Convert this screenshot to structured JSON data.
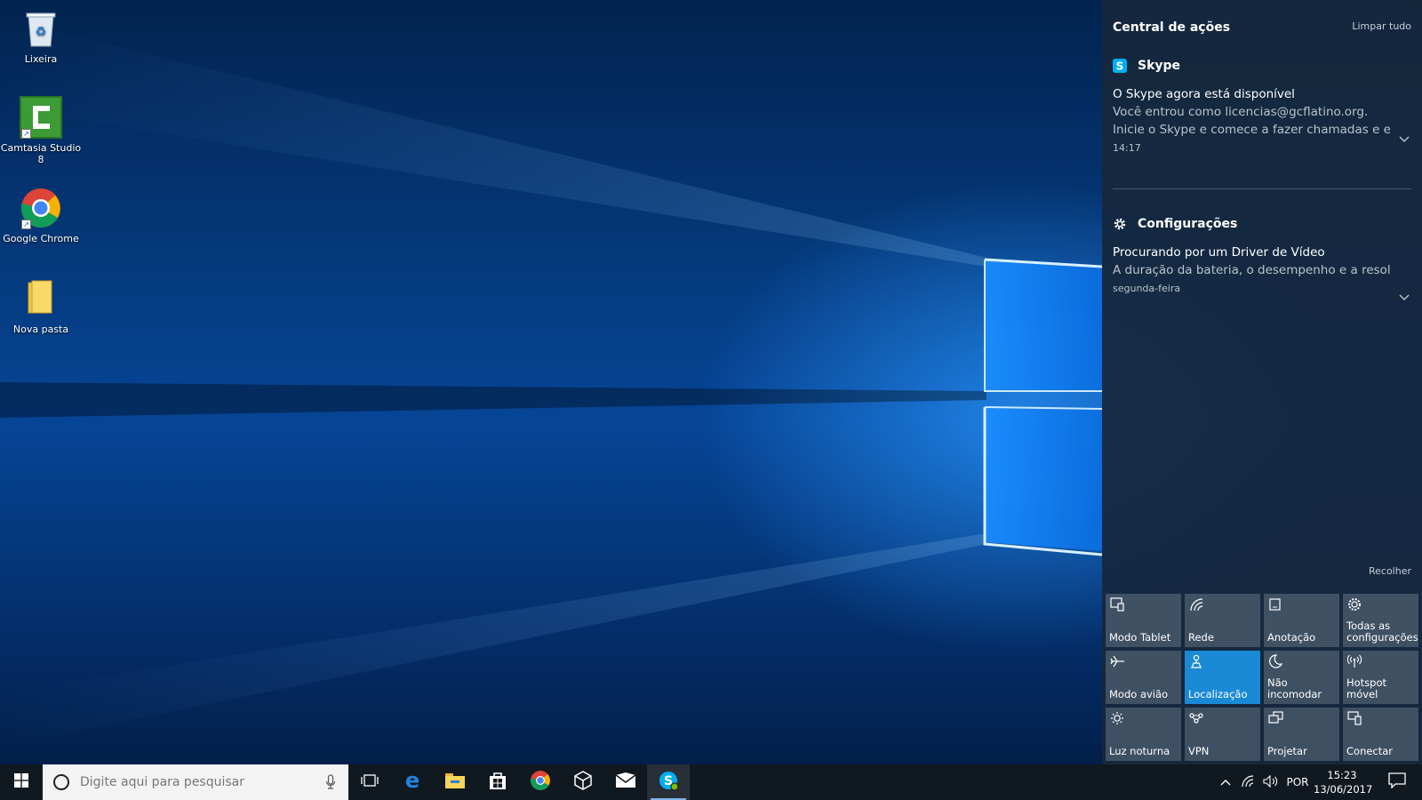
{
  "desktop": {
    "icons": [
      {
        "label": "Lixeira",
        "icon": "recycle-bin-icon"
      },
      {
        "label": "Camtasia Studio 8",
        "icon": "camtasia-icon"
      },
      {
        "label": "Google Chrome",
        "icon": "chrome-icon"
      },
      {
        "label": "Nova pasta",
        "icon": "folder-icon"
      }
    ]
  },
  "action_center": {
    "title": "Central de ações",
    "clear_all": "Limpar tudo",
    "groups": [
      {
        "app": "Skype",
        "icon": "skype-icon",
        "notification": {
          "title": "O Skype agora está disponível",
          "line1": "Você entrou como licencias@gcflatino.org.",
          "line2": "Inicie o Skype e comece a fazer chamadas e env",
          "time": "14:17"
        }
      },
      {
        "app": "Configurações",
        "icon": "gear-icon",
        "notification": {
          "title": "Procurando por um Driver de Vídeo",
          "line1": "A duração da bateria, o desempenho e a resolu",
          "time": "segunda-feira"
        }
      }
    ],
    "collapse": "Recolher",
    "quick_actions": [
      {
        "label": "Modo Tablet",
        "icon": "tablet-mode-icon",
        "active": false
      },
      {
        "label": "Rede",
        "icon": "network-icon",
        "active": false
      },
      {
        "label": "Anotação",
        "icon": "note-icon",
        "active": false
      },
      {
        "label": "Todas as configurações",
        "icon": "settings-icon",
        "active": false
      },
      {
        "label": "Modo avião",
        "icon": "airplane-icon",
        "active": false
      },
      {
        "label": "Localização",
        "icon": "location-icon",
        "active": true
      },
      {
        "label": "Não incomodar",
        "icon": "moon-icon",
        "active": false
      },
      {
        "label": "Hotspot móvel",
        "icon": "hotspot-icon",
        "active": false
      },
      {
        "label": "Luz noturna",
        "icon": "brightness-icon",
        "active": false
      },
      {
        "label": "VPN",
        "icon": "vpn-icon",
        "active": false
      },
      {
        "label": "Projetar",
        "icon": "project-icon",
        "active": false
      },
      {
        "label": "Conectar",
        "icon": "connect-icon",
        "active": false
      }
    ]
  },
  "taskbar": {
    "search_placeholder": "Digite aqui para pesquisar",
    "language": "POR",
    "time": "15:23",
    "date": "13/06/2017"
  },
  "colors": {
    "accent": "#1a8ad6",
    "taskbar": "#101820",
    "action_center": "#16283c"
  }
}
